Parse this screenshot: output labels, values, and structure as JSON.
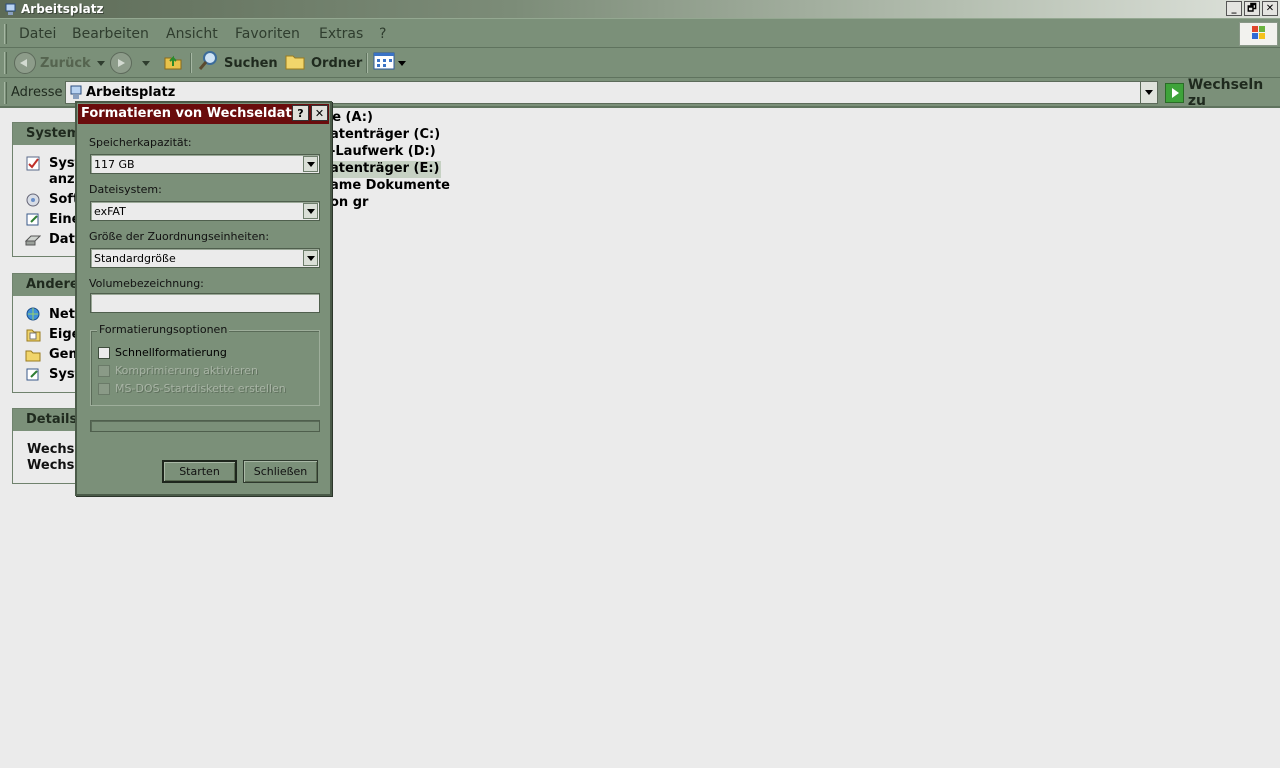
{
  "window": {
    "title": "Arbeitsplatz",
    "buttons": [
      "_",
      "🗗",
      "✕"
    ]
  },
  "menu": [
    "Datei",
    "Bearbeiten",
    "Ansicht",
    "Favoriten",
    "Extras",
    "?"
  ],
  "toolbar": {
    "back": "Zurück",
    "search": "Suchen",
    "folders": "Ordner"
  },
  "address": {
    "label": "Adresse",
    "value": "Arbeitsplatz",
    "go": "Wechseln zu"
  },
  "panes": {
    "system": {
      "title": "Systema",
      "items": [
        "Syst",
        "anze",
        "Soft",
        "Eine",
        "Date"
      ]
    },
    "other": {
      "title": "Andere",
      "items": [
        "Netz",
        "Eige",
        "Gem",
        "Syst"
      ]
    },
    "details": {
      "title": "Details",
      "lines": [
        "Wechse",
        "Wechse"
      ]
    }
  },
  "drives": [
    "te (A:)",
    "atenträger (C:)",
    "-Laufwerk (D:)",
    "atenträger (E:)",
    "ame Dokumente",
    "on gr"
  ],
  "dialog": {
    "title": "Formatieren von Wechseldaten...",
    "capacity_label": "Speicherkapazität:",
    "capacity_value": "117 GB",
    "fs_label": "Dateisystem:",
    "fs_value": "exFAT",
    "alloc_label": "Größe der Zuordnungseinheiten:",
    "alloc_value": "Standardgröße",
    "volume_label": "Volumebezeichnung:",
    "volume_value": "",
    "options_title": "Formatierungsoptionen",
    "opt_quick": "Schnellformatierung",
    "opt_compress": "Komprimierung aktivieren",
    "opt_msdos": "MS-DOS-Startdiskette erstellen",
    "start": "Starten",
    "close": "Schließen",
    "help_btn": "?",
    "close_btn": "✕"
  }
}
